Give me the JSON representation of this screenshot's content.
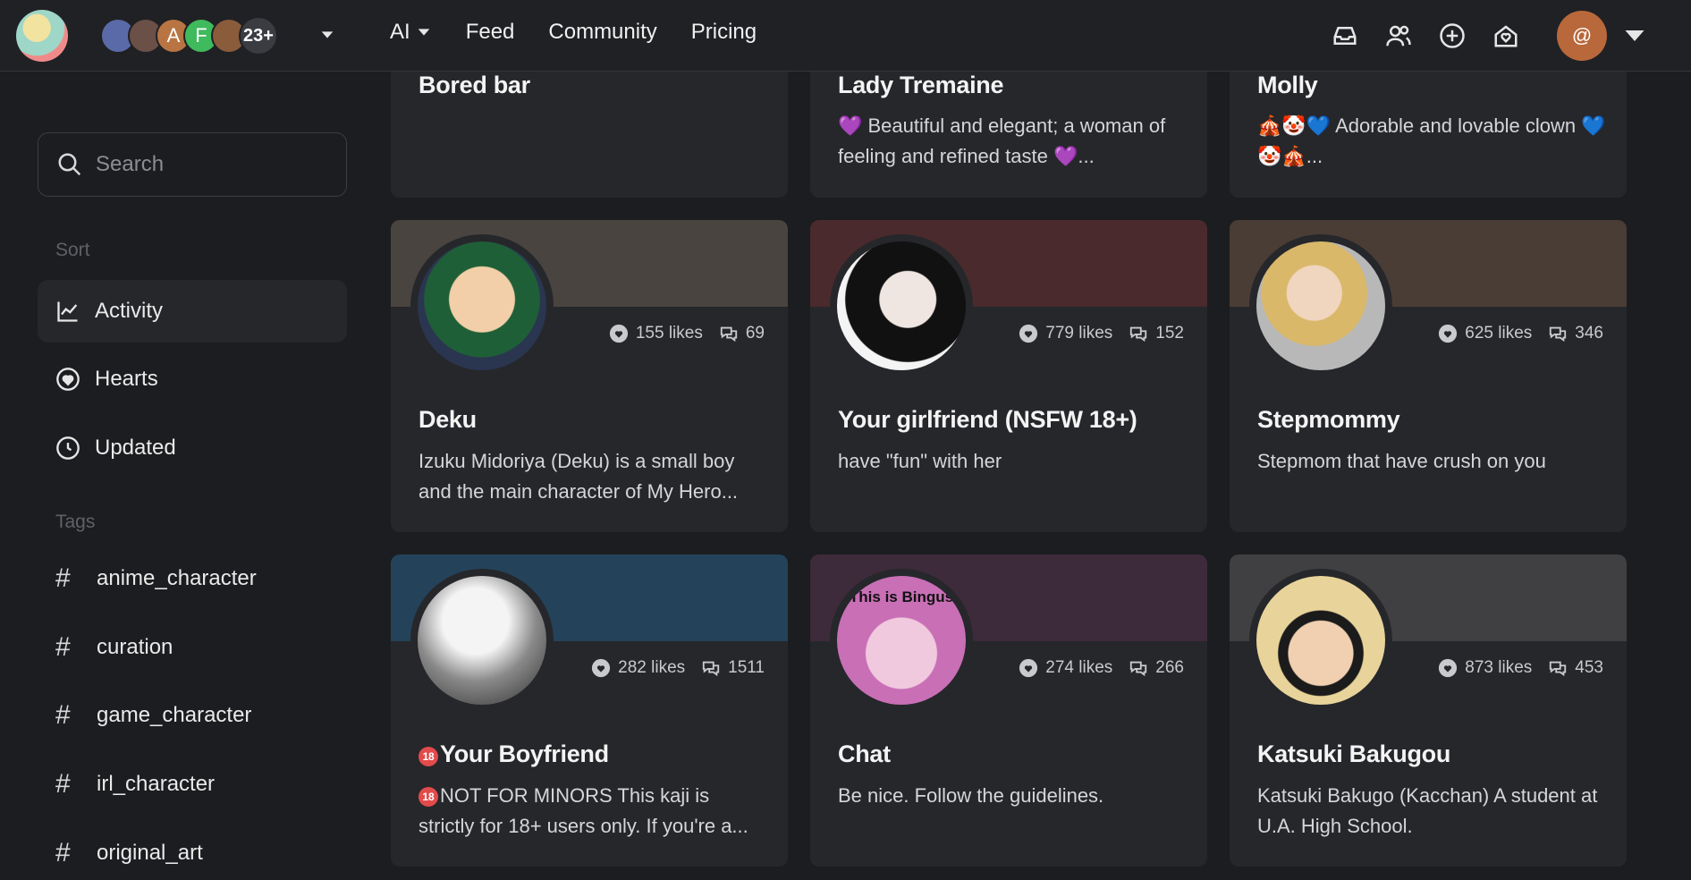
{
  "topbar": {
    "users_more_count": "23+",
    "user_initials": [
      "A",
      "F"
    ],
    "nav": [
      {
        "label": "AI",
        "has_dropdown": true
      },
      {
        "label": "Feed"
      },
      {
        "label": "Community"
      },
      {
        "label": "Pricing"
      }
    ],
    "profile_initial": "@"
  },
  "sidebar": {
    "search_placeholder": "Search",
    "sort_title": "Sort",
    "sort_items": [
      {
        "label": "Activity",
        "icon": "chart-line-icon",
        "active": true
      },
      {
        "label": "Hearts",
        "icon": "heart-circle-icon"
      },
      {
        "label": "Updated",
        "icon": "clock-icon"
      }
    ],
    "tags_title": "Tags",
    "tags": [
      "anime_character",
      "curation",
      "game_character",
      "irl_character",
      "original_art"
    ]
  },
  "cards_top_row": [
    {
      "title": "Bored bar",
      "desc": ""
    },
    {
      "title": "Lady Tremaine",
      "desc": "💜 Beautiful and elegant; a woman of feeling and refined taste 💜..."
    },
    {
      "title": "Molly",
      "desc": "🎪🤡💙 Adorable and lovable clown 💙🤡🎪..."
    }
  ],
  "cards": [
    {
      "title": "Deku",
      "likes": "155 likes",
      "comments": "69",
      "desc": "Izuku Midoriya (Deku) is a small boy and the main character of My Hero...",
      "banner": "#4a4440",
      "avatar": "#2f6a3f"
    },
    {
      "title": "Your girlfriend (NSFW 18+)",
      "likes": "779 likes",
      "comments": "152",
      "desc": "have \"fun\" with her",
      "banner": "#4a2a2c",
      "avatar": "#e9e9e9"
    },
    {
      "title": "Stepmommy",
      "likes": "625 likes",
      "comments": "346",
      "desc": "Stepmom that have crush on you",
      "banner": "#4a3d35",
      "avatar": "#c9b8a4"
    },
    {
      "title": "Your Boyfriend",
      "title_badge": "18",
      "likes": "282 likes",
      "comments": "1511",
      "desc": "NOT FOR MINORS This kaji is strictly for 18+ users only. If you're a...",
      "desc_badge": "18",
      "banner": "#24435a",
      "avatar": "#9b9b9b"
    },
    {
      "title": "Chat",
      "likes": "274 likes",
      "comments": "266",
      "desc": "Be nice. Follow the guidelines.",
      "banner": "#3d2a3a",
      "avatar": "#c86fb6",
      "avatar_text": "This is Bingus"
    },
    {
      "title": "Katsuki Bakugou",
      "likes": "873 likes",
      "comments": "453",
      "desc": "Katsuki Bakugo (Kacchan) A student at U.A. High School.",
      "banner": "#404042",
      "avatar": "#e8d49a"
    }
  ]
}
